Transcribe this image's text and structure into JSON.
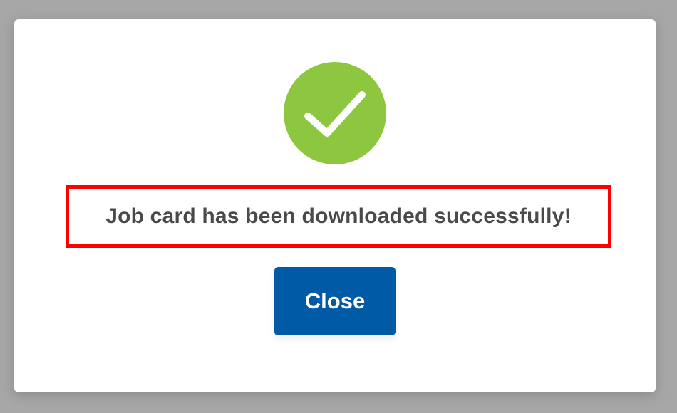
{
  "dialog": {
    "icon": "checkmark-circle-icon",
    "message": "Job card has been downloaded successfully!",
    "close_label": "Close"
  },
  "colors": {
    "success_green": "#8dc63f",
    "highlight_red": "#ff0000",
    "button_blue": "#005aa6",
    "message_text": "#4a4a4a"
  }
}
